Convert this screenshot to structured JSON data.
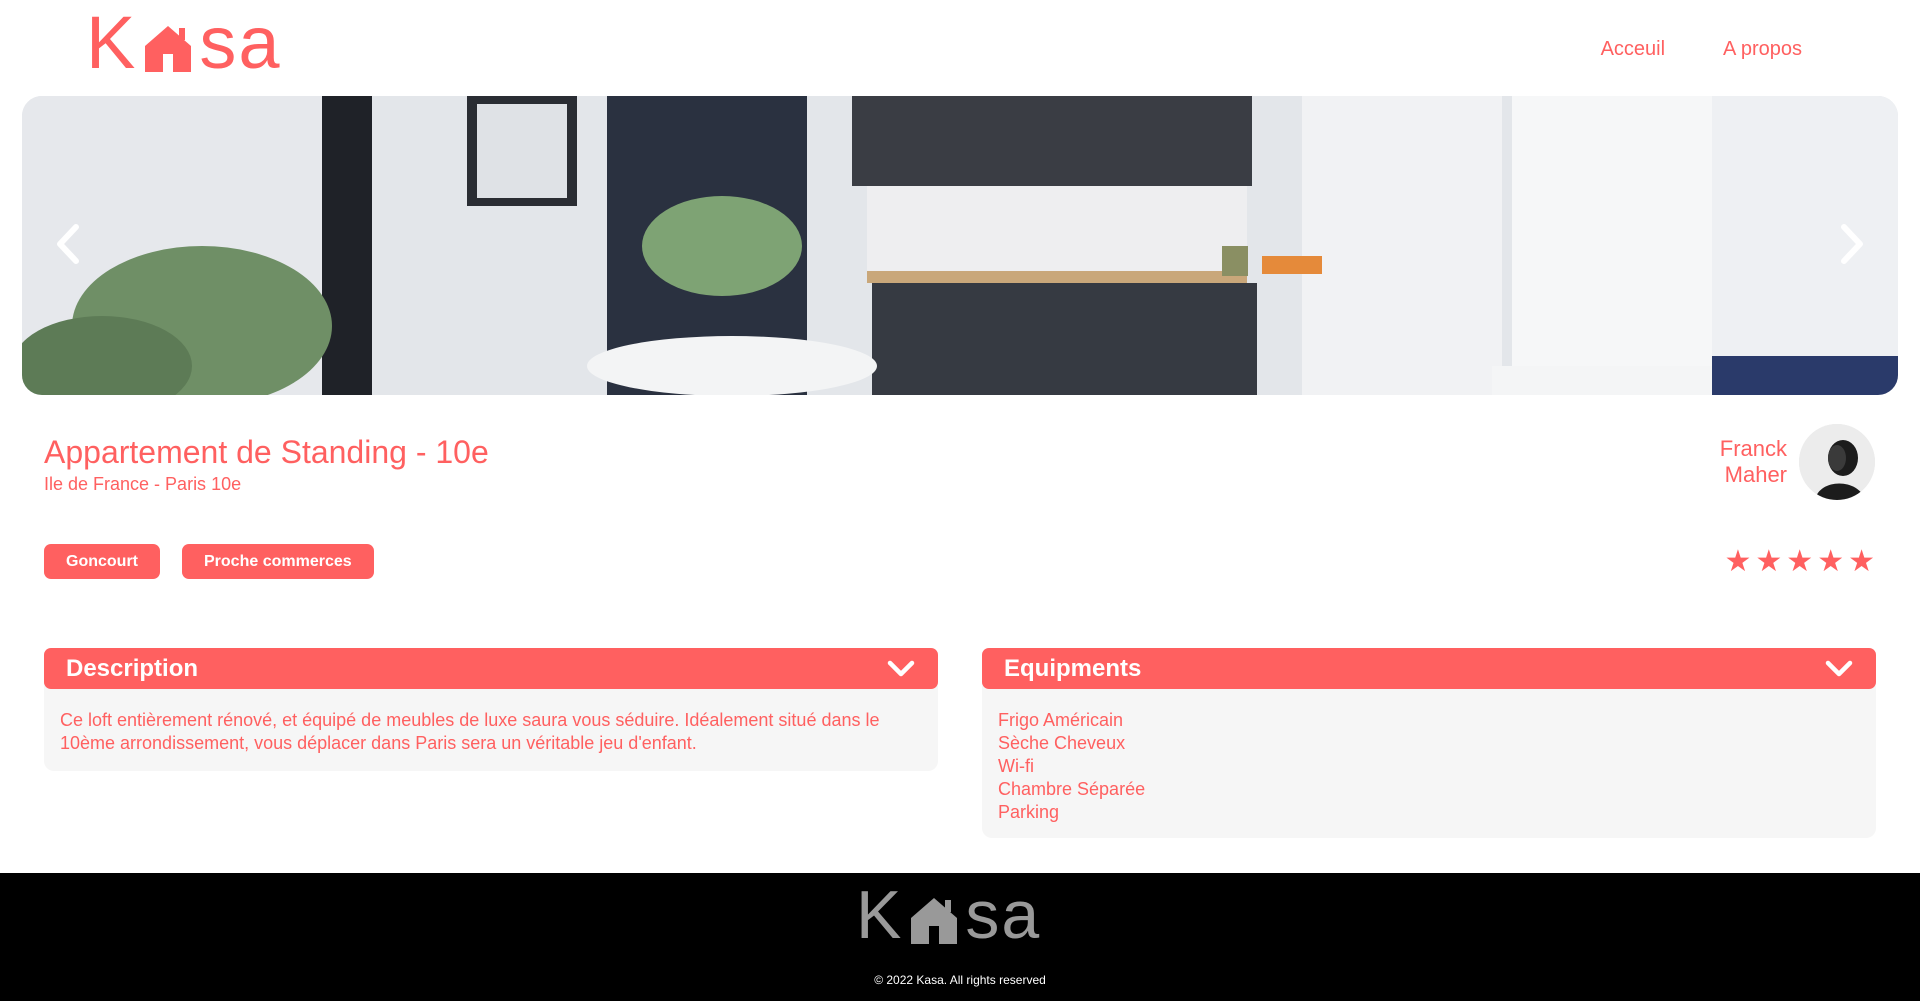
{
  "brand": {
    "logo_letters": [
      "K",
      "s",
      "a"
    ],
    "accent": "#FF6060",
    "footer_bg": "#000000"
  },
  "nav": {
    "items": [
      {
        "label": "Acceuil"
      },
      {
        "label": "A propos"
      }
    ]
  },
  "banner": {
    "icons": {
      "prev": "chevron-left-icon",
      "next": "chevron-right-icon"
    }
  },
  "listing": {
    "title": "Appartement de Standing - 10e",
    "location": "Ile de France - Paris 10e",
    "tags": [
      "Goncourt",
      "Proche commerces"
    ],
    "host": {
      "first_name": "Franck",
      "last_name": "Maher"
    },
    "rating": {
      "value": 5,
      "max": 5
    }
  },
  "description": {
    "title": "Description",
    "text": "Ce loft entièrement rénové, et équipé de meubles de luxe saura vous séduire. Idéalement situé dans le 10ème arrondissement, vous déplacer dans Paris sera un véritable jeu d'enfant."
  },
  "equipments": {
    "title": "Equipments",
    "items": [
      "Frigo Américain",
      "Sèche Cheveux",
      "Wi-fi",
      "Chambre Séparée",
      "Parking"
    ]
  },
  "footer": {
    "copyright": "© 2022 Kasa. All rights reserved"
  }
}
